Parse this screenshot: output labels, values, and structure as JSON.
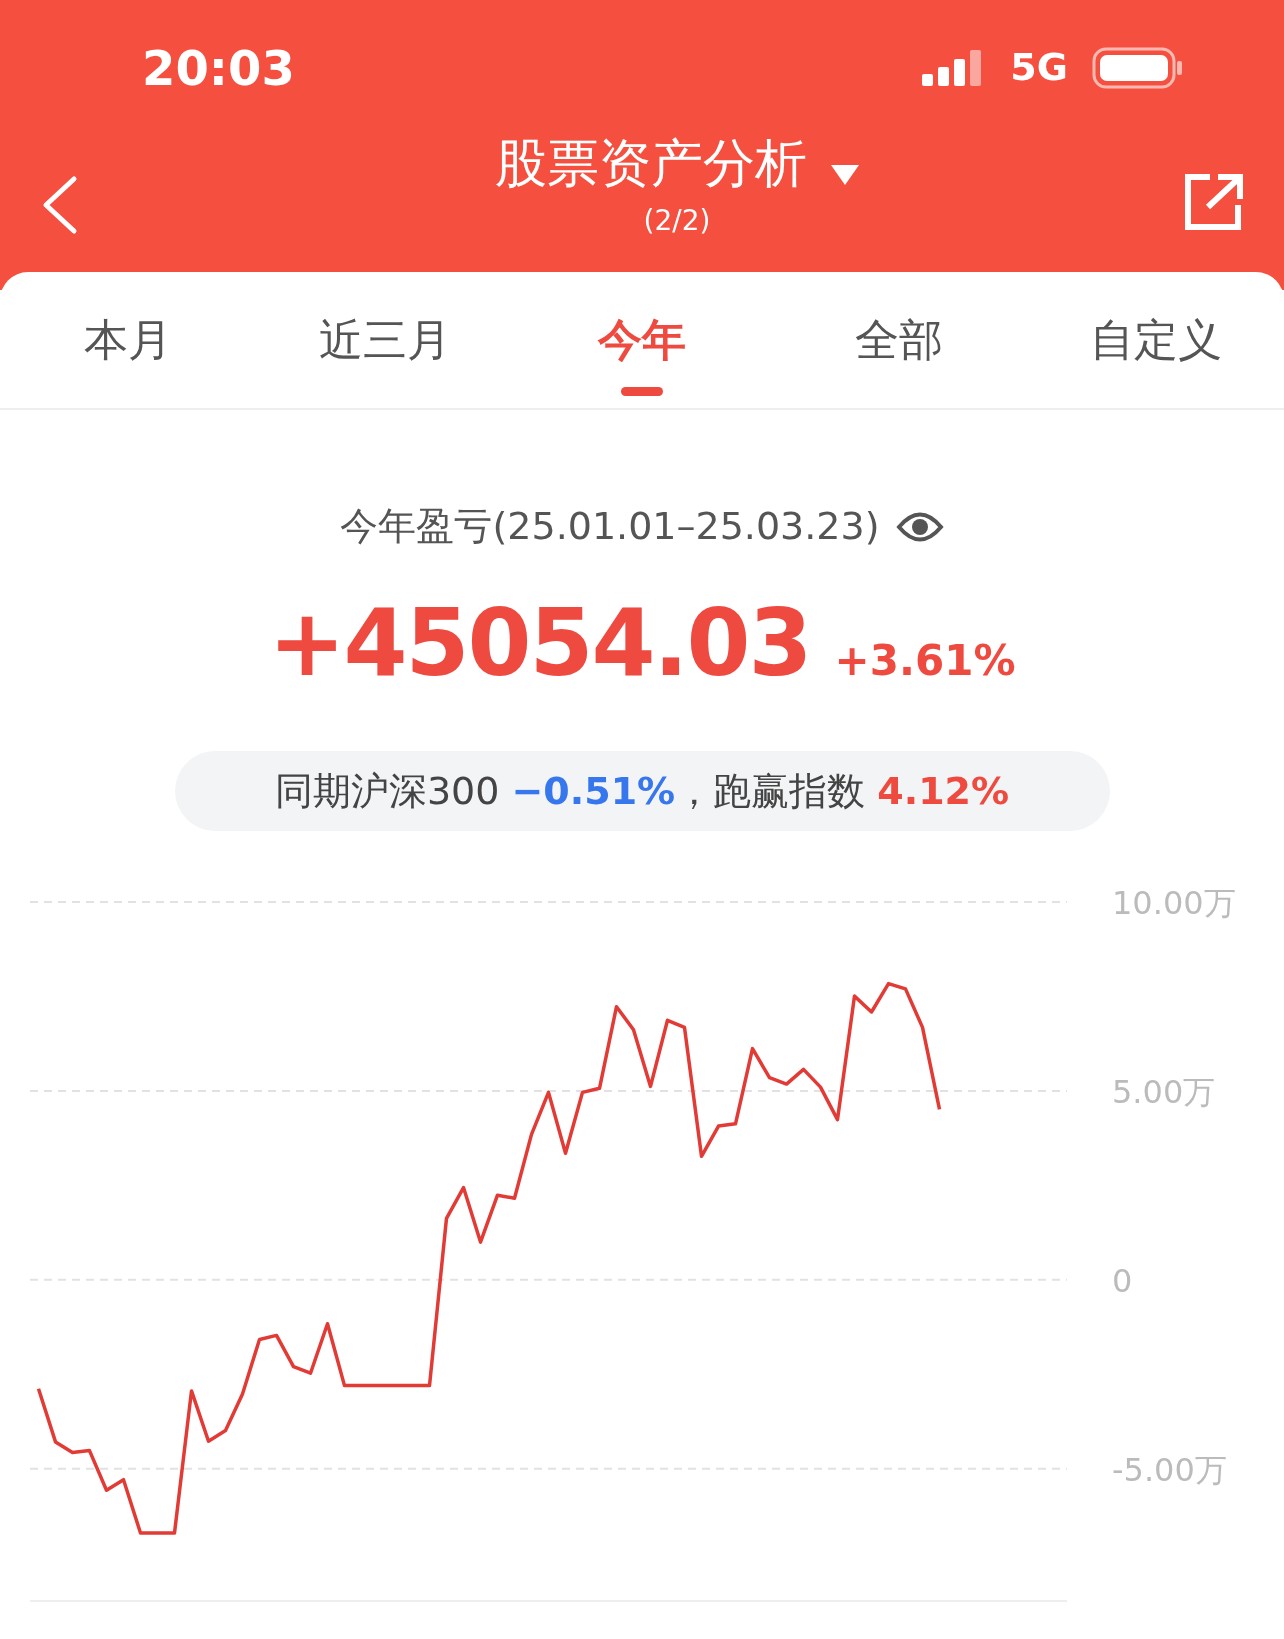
{
  "status_bar": {
    "time": "20:03",
    "network": "5G"
  },
  "header": {
    "title": "股票资产分析",
    "subtitle": "(2/2)"
  },
  "tabs": [
    {
      "label": "本月",
      "selected": false
    },
    {
      "label": "近三月",
      "selected": false
    },
    {
      "label": "今年",
      "selected": true
    },
    {
      "label": "全部",
      "selected": false
    },
    {
      "label": "自定义",
      "selected": false
    }
  ],
  "summary": {
    "title": "今年盈亏(25.01.01–25.03.23)",
    "profit": "+45054.03",
    "percent": "+3.61%"
  },
  "benchmark": {
    "prefix": "同期沪深300",
    "index_change": "−0.51%",
    "separator": "，跑赢指数",
    "excess": "4.12%"
  },
  "chart_data": {
    "type": "line",
    "grid": true,
    "ylim": [
      -8.5,
      10
    ],
    "yticks": [
      {
        "value": 10,
        "label": "10.00万"
      },
      {
        "value": 5,
        "label": "5.00万"
      },
      {
        "value": 0,
        "label": "0"
      },
      {
        "value": -5,
        "label": "-5.00万"
      }
    ],
    "categories": [
      null,
      null,
      null,
      null,
      null,
      null,
      null,
      null,
      null,
      null,
      null,
      null,
      null,
      null,
      null,
      null,
      null,
      null,
      null,
      null,
      null,
      null,
      null,
      null,
      null,
      null,
      null,
      null,
      null,
      null,
      null,
      null,
      null,
      null,
      null,
      null,
      null,
      null,
      null,
      null,
      null,
      null,
      null,
      null,
      null,
      null,
      null,
      null,
      null,
      null,
      null,
      null,
      null,
      null,
      null,
      null,
      null,
      null,
      null,
      null,
      null
    ],
    "series": [
      {
        "color": "#e23b36",
        "values": [
          -2.88,
          -4.29,
          -4.57,
          -4.52,
          -5.57,
          -5.29,
          -6.7,
          -6.7,
          -6.7,
          -2.94,
          -4.27,
          -3.99,
          -3.02,
          -1.58,
          -1.47,
          -2.3,
          -2.47,
          -1.16,
          -2.8,
          -2.8,
          -2.8,
          -2.8,
          -2.8,
          -2.8,
          1.63,
          2.44,
          1.0,
          2.24,
          2.16,
          3.85,
          4.96,
          3.35,
          4.96,
          5.07,
          7.23,
          6.62,
          5.12,
          6.87,
          6.68,
          3.27,
          4.07,
          4.13,
          6.12,
          5.35,
          5.18,
          5.57,
          5.1,
          4.24,
          7.51,
          7.09,
          7.84,
          7.7,
          6.68,
          4.51,
          null,
          null,
          null,
          null,
          null,
          null,
          null
        ]
      }
    ]
  }
}
